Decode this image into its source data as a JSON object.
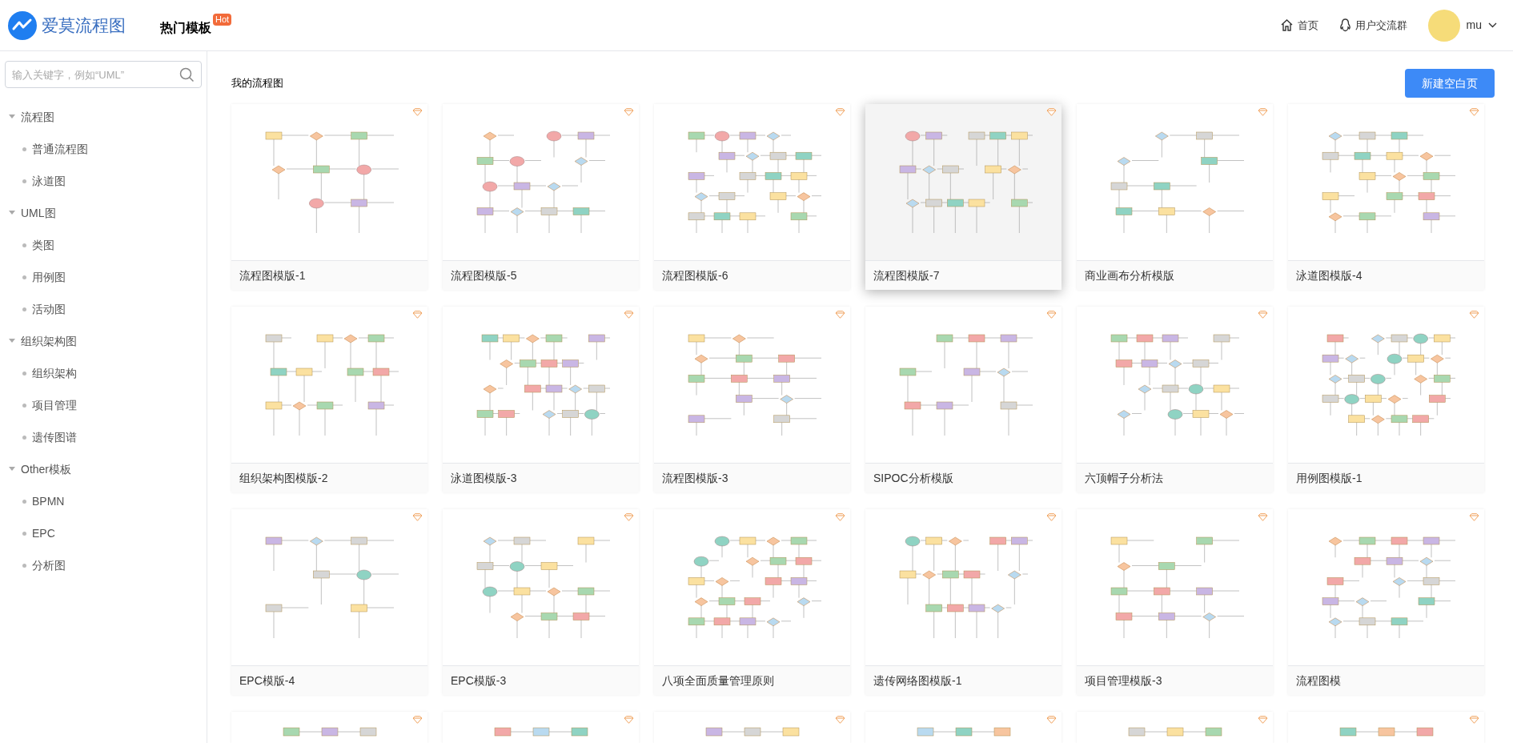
{
  "header": {
    "logo_text": "爱莫流程图",
    "nav": {
      "label": "热门模板",
      "badge": "Hot"
    },
    "links": [
      {
        "kind": "home",
        "label": "首页"
      },
      {
        "kind": "group",
        "label": "用户交流群"
      }
    ],
    "user": {
      "name": "mu"
    }
  },
  "sidebar": {
    "search": {
      "placeholder": "输入关键字，例如“UML”"
    },
    "items": [
      {
        "label": "流程图",
        "expanded": true,
        "children": [
          {
            "label": "普通流程图"
          },
          {
            "label": "泳道图"
          }
        ]
      },
      {
        "label": "UML图",
        "expanded": true,
        "children": [
          {
            "label": "类图"
          },
          {
            "label": "用例图"
          },
          {
            "label": "活动图"
          }
        ]
      },
      {
        "label": "组织架构图",
        "expanded": true,
        "children": [
          {
            "label": "组织架构"
          },
          {
            "label": "项目管理"
          },
          {
            "label": "遗传图谱"
          }
        ]
      },
      {
        "label": "Other模板",
        "expanded": true,
        "children": [
          {
            "label": "BPMN"
          },
          {
            "label": "EPC"
          },
          {
            "label": "分析图"
          }
        ]
      }
    ]
  },
  "main": {
    "title": "我的流程图",
    "new_button": "新建空白页",
    "cards": [
      {
        "kind": "full",
        "title": "流程图模版-1",
        "highlighted": false
      },
      {
        "kind": "full",
        "title": "流程图模版-5",
        "highlighted": false
      },
      {
        "kind": "full",
        "title": "流程图模版-6",
        "highlighted": false
      },
      {
        "kind": "full",
        "title": "流程图模版-7",
        "highlighted": true
      },
      {
        "kind": "full",
        "title": "商业画布分析模版",
        "highlighted": false
      },
      {
        "kind": "full",
        "title": "泳道图模版-4",
        "highlighted": false
      },
      {
        "kind": "full",
        "title": "组织架构图模版-2",
        "highlighted": false
      },
      {
        "kind": "full",
        "title": "泳道图模版-3",
        "highlighted": false
      },
      {
        "kind": "full",
        "title": "流程图模版-3",
        "highlighted": false
      },
      {
        "kind": "full",
        "title": "SIPOC分析模版",
        "highlighted": false
      },
      {
        "kind": "full",
        "title": "六顶帽子分析法",
        "highlighted": false
      },
      {
        "kind": "full",
        "title": "用例图模版-1",
        "highlighted": false
      },
      {
        "kind": "full",
        "title": "EPC模版-4",
        "highlighted": false
      },
      {
        "kind": "full",
        "title": "EPC模版-3",
        "highlighted": false
      },
      {
        "kind": "full",
        "title": "八项全面质量管理原则",
        "highlighted": false
      },
      {
        "kind": "full",
        "title": "遗传网络图模版-1",
        "highlighted": false
      },
      {
        "kind": "full",
        "title": "项目管理模版-3",
        "highlighted": false
      },
      {
        "kind": "full",
        "title": "流程图模",
        "highlighted": false
      },
      {
        "kind": "partial",
        "highlighted": false
      },
      {
        "kind": "partial",
        "highlighted": false
      },
      {
        "kind": "partial",
        "highlighted": false
      },
      {
        "kind": "partial",
        "highlighted": false
      },
      {
        "kind": "partial",
        "highlighted": false
      },
      {
        "kind": "partial",
        "highlighted": false
      }
    ]
  }
}
